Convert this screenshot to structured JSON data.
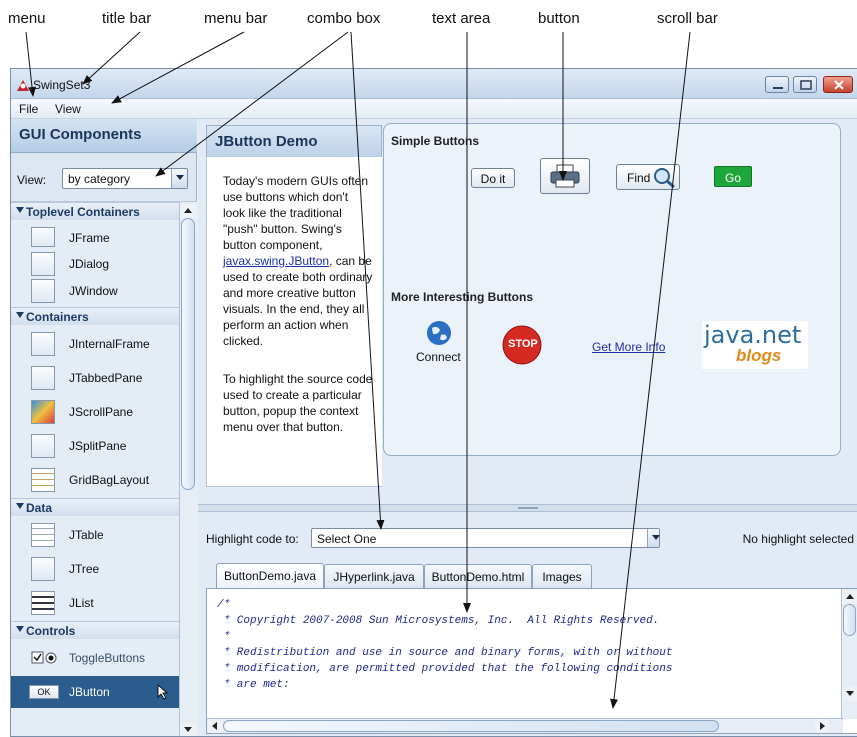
{
  "callouts": {
    "menu": "menu",
    "title_bar": "title bar",
    "menu_bar": "menu bar",
    "combo_box": "combo box",
    "text_area": "text area",
    "button": "button",
    "scroll_bar": "scroll bar"
  },
  "window": {
    "title": "SwingSet3",
    "accent_color": "#2a5d8e",
    "close_color": "#c8412c"
  },
  "menubar": {
    "items": [
      "File",
      "View"
    ]
  },
  "left_panel": {
    "title": "GUI Components",
    "view_label": "View:",
    "view_value": "by category",
    "categories": {
      "toplevel": "Toplevel Containers",
      "containers": "Containers",
      "data": "Data",
      "controls": "Controls"
    },
    "items": {
      "jframe": "JFrame",
      "jdialog": "JDialog",
      "jwindow": "JWindow",
      "jinternalframe": "JInternalFrame",
      "jtabbedpane": "JTabbedPane",
      "jscrollpane": "JScrollPane",
      "jsplitpane": "JSplitPane",
      "gridbaglayout": "GridBagLayout",
      "jtable": "JTable",
      "jtree": "JTree",
      "jlist": "JList",
      "togglebuttons": "ToggleButtons",
      "jbutton": "JButton"
    },
    "ok_icon_text": "OK"
  },
  "demo": {
    "tab_title": "JButton Demo",
    "description_1_before": "Today's modern GUIs often use buttons which don't look like the traditional \"push\" button. Swing's button component,",
    "description_1_link": "javax.swing.JButton",
    "description_1_after": ", can be used to create both ordinary and more creative button visuals. In the end, they all perform an action when clicked.",
    "description_2": "To highlight the source code used to create a particular button, popup the context menu over that button.",
    "simple_title": "Simple Buttons",
    "doit_label": "Do it",
    "find_label": "Find",
    "go_label": "Go",
    "interesting_title": "More Interesting Buttons",
    "connect_label": "Connect",
    "stop_label": "STOP",
    "more_info_label": "Get More Info",
    "javanet_text": "java.net",
    "blogs_text": "blogs"
  },
  "code": {
    "highlight_label": "Highlight code to:",
    "highlight_value": "Select One",
    "highlight_status": "No highlight selected",
    "tabs": [
      "ButtonDemo.java",
      "JHyperlink.java",
      "ButtonDemo.html",
      "Images"
    ],
    "lines": [
      "/*",
      " * Copyright 2007-2008 Sun Microsystems, Inc.  All Rights Reserved.",
      " *",
      " * Redistribution and use in source and binary forms, with or without",
      " * modification, are permitted provided that the following conditions",
      " * are met:"
    ]
  }
}
